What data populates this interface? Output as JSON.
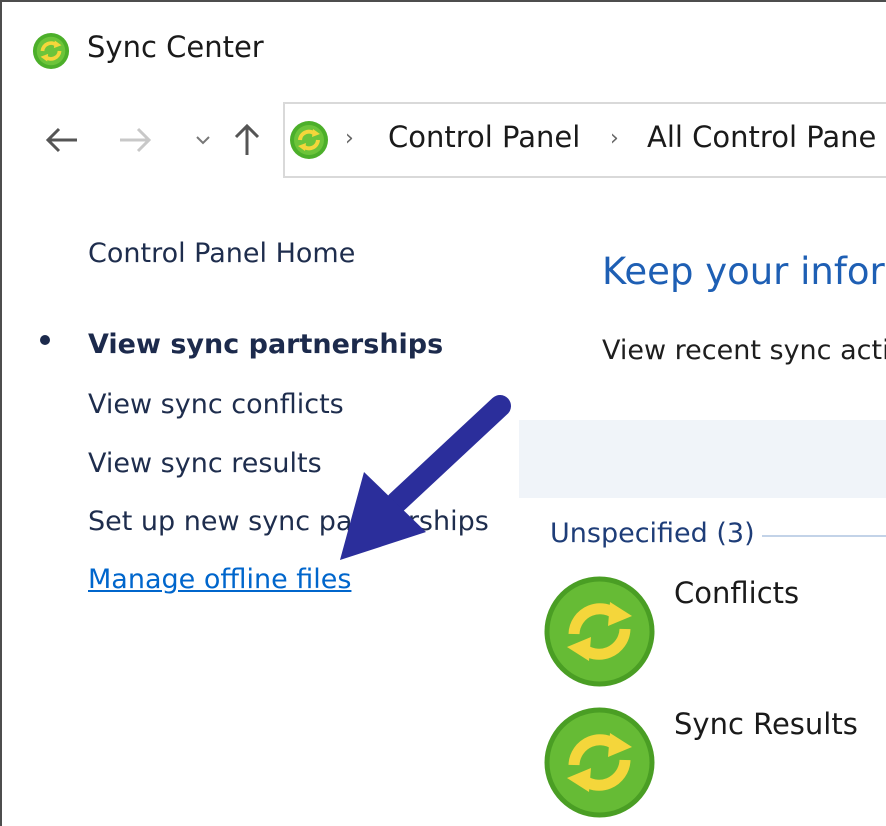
{
  "window": {
    "title": "Sync Center",
    "title_icon": "sync-center-icon"
  },
  "navigation": {
    "back_icon": "back-arrow-icon",
    "forward_icon": "forward-arrow-icon",
    "recent_icon": "chevron-down-icon",
    "up_icon": "up-arrow-icon",
    "address_icon": "sync-center-icon",
    "breadcrumbs": [
      {
        "label": "Control Panel"
      },
      {
        "label": "All Control Pane"
      }
    ]
  },
  "sidebar": {
    "items": [
      {
        "label": "Control Panel Home",
        "current": false,
        "link": false
      },
      {
        "label": "View sync partnerships",
        "current": true,
        "link": false
      },
      {
        "label": "View sync conflicts",
        "current": false,
        "link": false
      },
      {
        "label": "View sync results",
        "current": false,
        "link": false
      },
      {
        "label": "Set up new sync partnerships",
        "current": false,
        "link": false
      },
      {
        "label": "Manage offline files",
        "current": false,
        "link": true
      }
    ]
  },
  "main": {
    "heading": "Keep your inforr",
    "description": "View recent sync acti",
    "group": {
      "label": "Unspecified (3)",
      "items": [
        {
          "label": "Conflicts",
          "icon": "sync-icon"
        },
        {
          "label": "Sync Results",
          "icon": "sync-icon"
        }
      ]
    }
  },
  "annotation": {
    "arrow_color": "#2b2e9b",
    "icon": "pointer-arrow-annotation"
  },
  "colors": {
    "accent": "#1e5fb4",
    "link": "#0066cc",
    "sync_green": "#4caf2a",
    "sync_yellow": "#f4d63b"
  }
}
